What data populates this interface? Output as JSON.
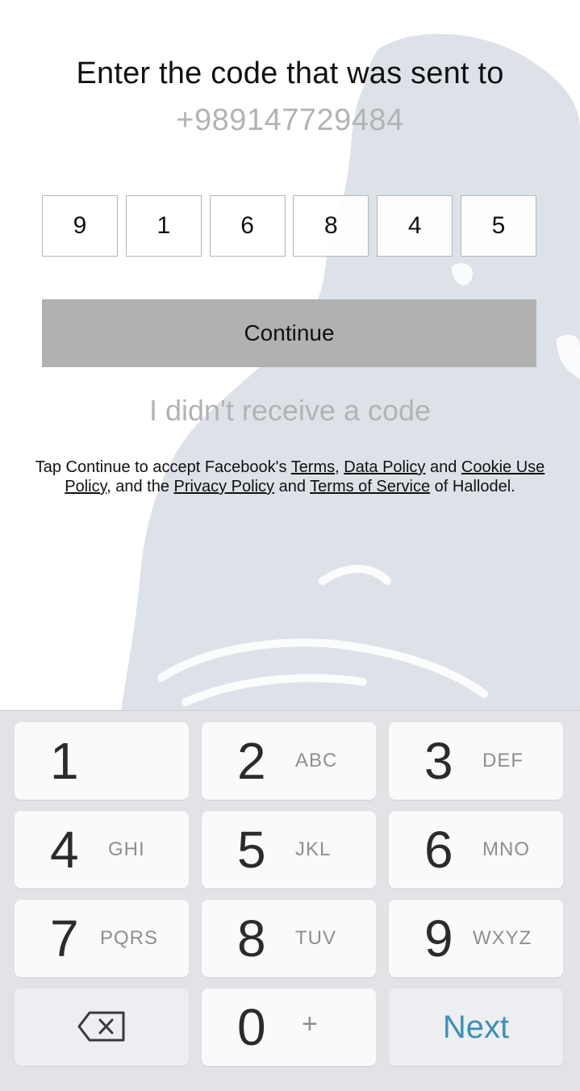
{
  "header": {
    "title": "Enter the code that was sent to",
    "phone_number": "+989147729484"
  },
  "code_digits": [
    "9",
    "1",
    "6",
    "8",
    "4",
    "5"
  ],
  "continue_label": "Continue",
  "resend_label": "I didn't receive a code",
  "legal": {
    "prefix": "Tap Continue to accept Facebook's ",
    "terms": "Terms",
    "sep1": ", ",
    "data_policy": "Data Policy",
    "and1": " and ",
    "cookie_policy": "Cookie Use Policy",
    "and_the": ", and the ",
    "privacy_policy": "Privacy Policy",
    "and2": " and ",
    "terms_of_service": "Terms of Service",
    "suffix": " of Hallodel."
  },
  "keyboard": {
    "keys": [
      {
        "digit": "1",
        "letters": ""
      },
      {
        "digit": "2",
        "letters": "ABC"
      },
      {
        "digit": "3",
        "letters": "DEF"
      },
      {
        "digit": "4",
        "letters": "GHI"
      },
      {
        "digit": "5",
        "letters": "JKL"
      },
      {
        "digit": "6",
        "letters": "MNO"
      },
      {
        "digit": "7",
        "letters": "PQRS"
      },
      {
        "digit": "8",
        "letters": "TUV"
      },
      {
        "digit": "9",
        "letters": "WXYZ"
      },
      {
        "digit": "0",
        "letters": "+"
      }
    ],
    "backspace_icon": "backspace-icon",
    "next_label": "Next"
  },
  "colors": {
    "continue_bg": "#b1b1b1",
    "muted_text": "#b3b3b3",
    "next_accent": "#3e8fb3",
    "keyboard_bg": "#e1e3e6"
  }
}
